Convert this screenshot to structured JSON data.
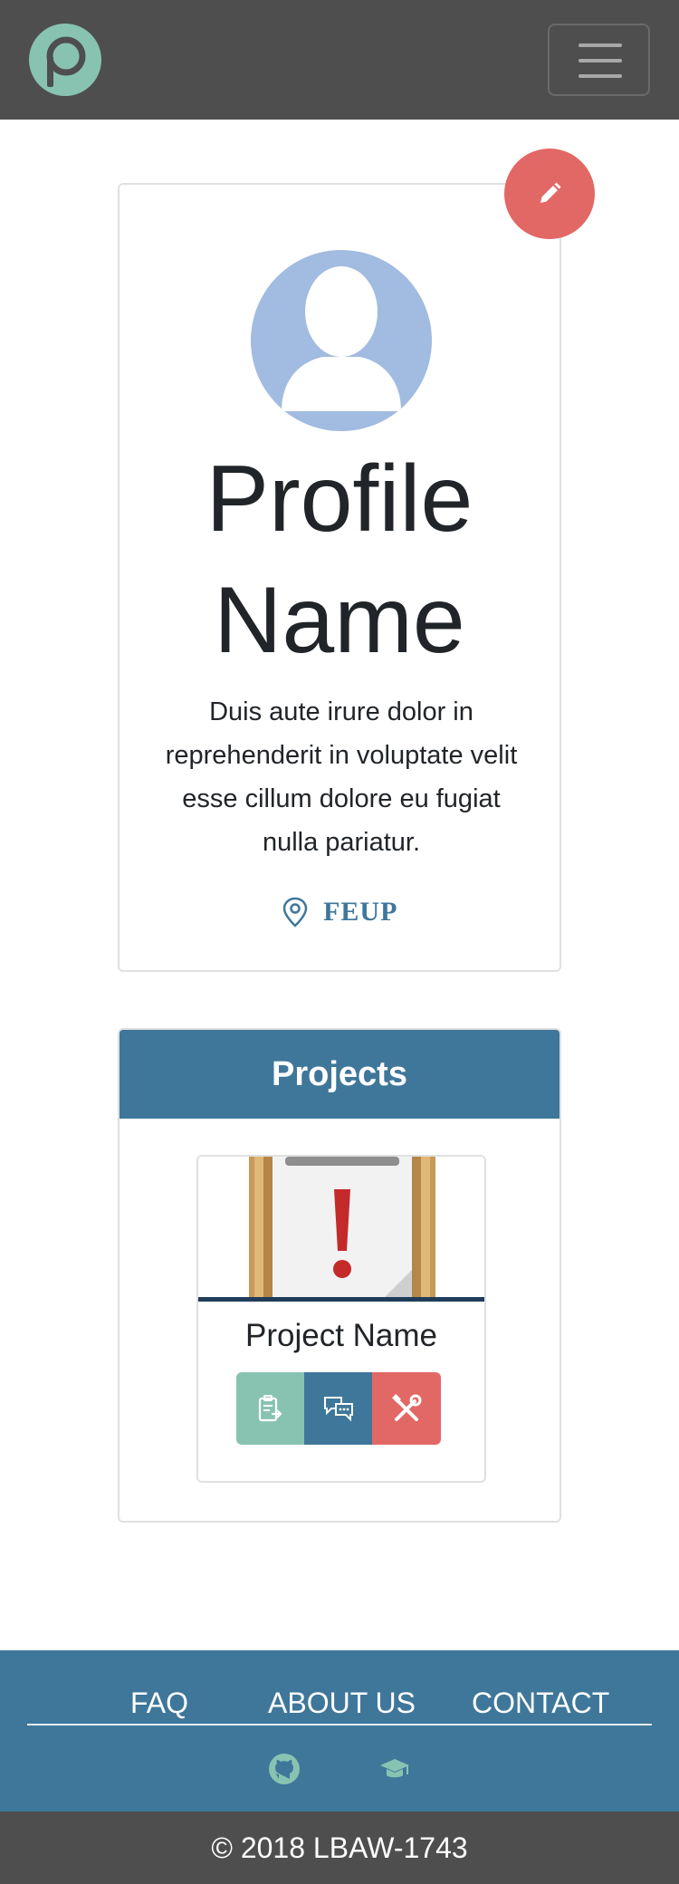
{
  "navbar": {
    "logo_icon": "p-logo-icon",
    "menu_icon": "hamburger-icon"
  },
  "profile": {
    "edit_icon": "pencil-icon",
    "avatar_icon": "user-silhouette-icon",
    "name": "Profile Name",
    "bio": "Duis aute irure dolor in reprehenderit in voluptate velit esse cillum dolore eu fugiat nulla pariatur.",
    "location_icon": "map-pin-icon",
    "location": "FEUP"
  },
  "projects": {
    "header": "Projects",
    "items": [
      {
        "name": "Project Name",
        "thumbnail_icon": "clipboard-exclamation-icon",
        "actions": [
          {
            "icon": "clipboard-task-icon",
            "color": "#88c3b2"
          },
          {
            "icon": "chat-bubbles-icon",
            "color": "#3f779a"
          },
          {
            "icon": "tools-icon",
            "color": "#e26865"
          }
        ]
      }
    ]
  },
  "footer": {
    "links": [
      "FAQ",
      "ABOUT US",
      "CONTACT"
    ],
    "icons": [
      "github-icon",
      "graduation-cap-icon"
    ],
    "copyright": "© 2018 LBAW-1743"
  },
  "colors": {
    "navbar_bg": "#4e4e4e",
    "primary": "#3f779a",
    "accent_teal": "#88c3b2",
    "accent_red": "#e26865",
    "avatar_bg": "#a2bbe0"
  }
}
